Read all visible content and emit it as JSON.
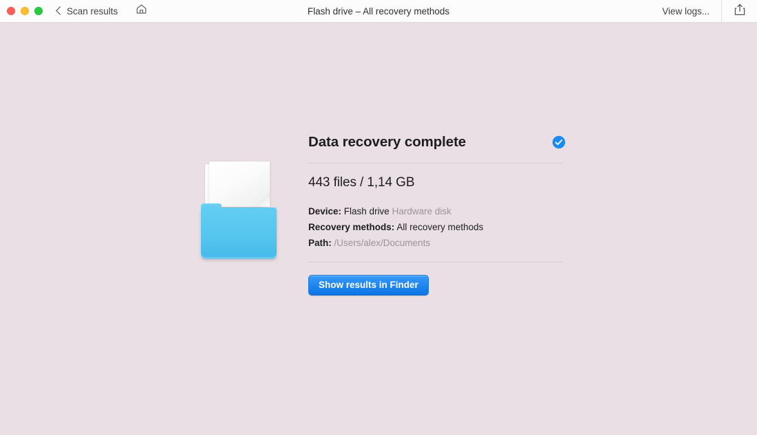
{
  "window": {
    "title": "Flash drive – All recovery methods",
    "back_label": "Scan results",
    "view_logs_label": "View logs...",
    "traffic_lights": [
      "close-red",
      "minimize-yellow",
      "zoom-green"
    ],
    "icons": {
      "back_chevron": "chevron-left-icon",
      "home": "home-icon",
      "share": "share-icon"
    },
    "colors": {
      "titlebar_bg": "#fdfcfc",
      "body_bg": "#e9dfe4",
      "close": "#ff5f57",
      "minimize": "#febc2e",
      "zoom": "#28c840"
    }
  },
  "result": {
    "heading": "Data recovery complete",
    "status_icon": "check-circle-icon",
    "status_color": "#1a8cf0",
    "summary": "443 files / 1,14 GB",
    "file_count": "443 files",
    "total_size": "1,14 GB",
    "details": [
      {
        "label": "Device:",
        "value": "Flash drive",
        "note": "Hardware disk"
      },
      {
        "label": "Recovery methods:",
        "value": "All recovery methods",
        "note": ""
      },
      {
        "label": "Path:",
        "value": "",
        "note": "/Users/alex/Documents"
      }
    ],
    "cta_label": "Show results in Finder",
    "cta_color": "#2188f0",
    "illustration": "folder-with-documents-icon"
  }
}
